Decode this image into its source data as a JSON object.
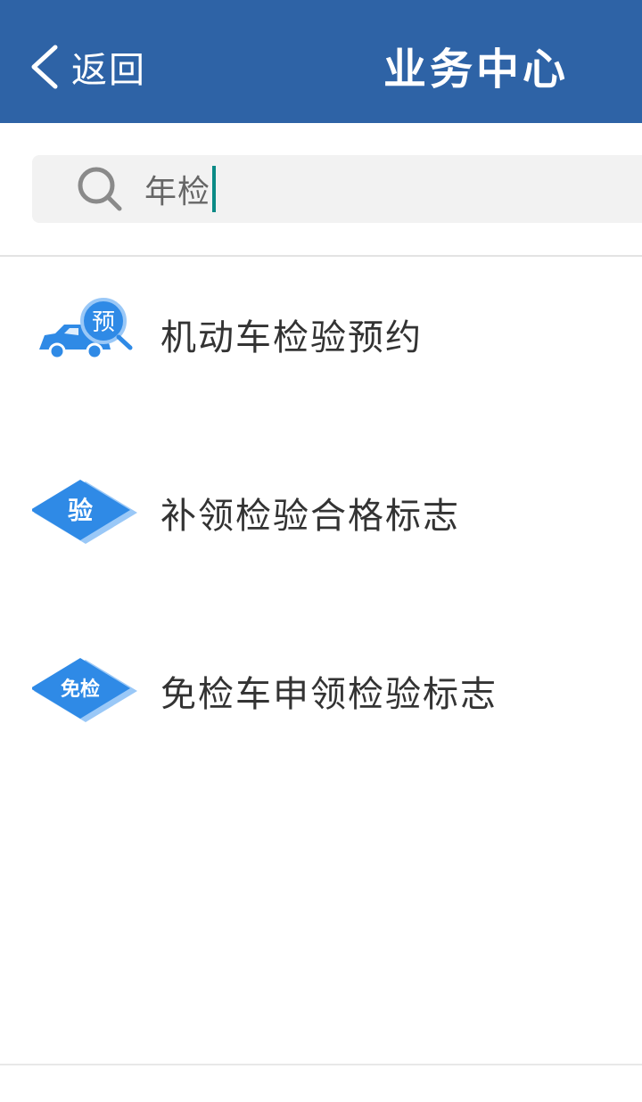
{
  "header": {
    "back_label": "返回",
    "title": "业务中心",
    "background": "#2e63a6"
  },
  "search": {
    "value": "年检",
    "icon": "search-icon"
  },
  "results": [
    {
      "label": "机动车检验预约",
      "icon": "car-appointment-icon",
      "badge": "预"
    },
    {
      "label": "补领检验合格标志",
      "icon": "inspection-diamond-icon",
      "badge": "验"
    },
    {
      "label": "免检车申领检验标志",
      "icon": "exemption-diamond-icon",
      "badge": "免检"
    }
  ],
  "colors": {
    "accent": "#2e63a6",
    "icon_blue": "#2f8ae6",
    "icon_light": "#9ac8f7",
    "cursor": "#0b8a86"
  }
}
